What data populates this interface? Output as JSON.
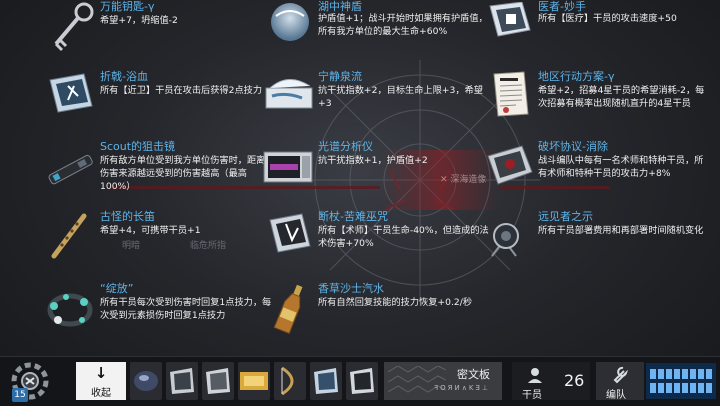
{
  "relics": [
    {
      "name": "万能钥匙-γ",
      "desc": "希望+7，坍缩值-2",
      "icon": "key-icon"
    },
    {
      "name": "湖中神盾",
      "desc": "护盾值+1；战斗开始时如果拥有护盾值，所有我方单位的最大生命+60%",
      "icon": "shield-orb-icon"
    },
    {
      "name": "医者-妙手",
      "desc": "所有【医疗】干员的攻击速度+50",
      "icon": "medic-book-icon"
    },
    {
      "name": "折戟-浴血",
      "desc": "所有【近卫】干员在攻击后获得2点技力",
      "icon": "guard-book-icon"
    },
    {
      "name": "宁静泉流",
      "desc": "抗干扰指数+2，目标生命上限+3，希望+3",
      "icon": "fountain-box-icon"
    },
    {
      "name": "地区行动方案-γ",
      "desc": "希望+2，招募4星干员的希望消耗-2，每次招募有概率出现随机直升的4星干员",
      "icon": "document-icon"
    },
    {
      "name": "Scout的狙击镜",
      "desc": "所有敌方单位受到我方单位伤害时，距离伤害来源越远受到的伤害越高（最高100%）",
      "icon": "scope-icon"
    },
    {
      "name": "光谱分析仪",
      "desc": "抗干扰指数+1，护盾值+2",
      "icon": "analyzer-icon"
    },
    {
      "name": "破坏协议-消除",
      "desc": "战斗编队中每有一名术师和特种干员，所有术师和特种干员的攻击力+8%",
      "icon": "protocol-card-icon"
    },
    {
      "name": "古怪的长笛",
      "desc": "希望+4，可携带干员+1",
      "icon": "flute-icon"
    },
    {
      "name": "断杖-苦难巫咒",
      "desc": "所有【术师】干员生命-40%，但造成的法术伤害+70%",
      "icon": "caster-book-icon"
    },
    {
      "name": "远见者之示",
      "desc": "所有干员部署费用和再部署时间随机变化",
      "icon": "telescope-icon"
    },
    {
      "name": "“绽放”",
      "desc": "所有干员每次受到伤害时回复1点技力，每次受到元素损伤时回复1点技力",
      "icon": "flower-wreath-icon"
    },
    {
      "name": "香草沙士汽水",
      "desc": "所有自然回复技能的技力恢复+0.2/秒",
      "icon": "soda-bottle-icon"
    }
  ],
  "background": {
    "tag_right": "✕ 深海造像",
    "tag_left": "明暗",
    "tag_mid": "临危所指"
  },
  "bottom": {
    "gear_badge": "15",
    "collapse_arrow": "↓",
    "collapse_label": "收起",
    "tablet_label": "密文板",
    "tablet_sub": "ꟻОЯИ∧ΚƎ⊥",
    "operators_label": "干员",
    "operators_count": "26",
    "squad_label": "编队"
  },
  "colors": {
    "accent_blue": "#5db4ea",
    "squad_blue": "#0d2a4a"
  }
}
